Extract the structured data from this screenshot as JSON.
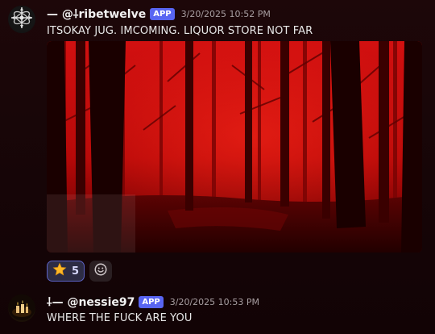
{
  "messages": [
    {
      "username": "— @⸸ribetwelve",
      "badge": "APP",
      "timestamp": "3/20/2025 10:52 PM",
      "text": "ITSOKAY JUG. IMCOMING. LIQUOR STORE NOT FAR",
      "avatar_icon": "orbital-cross-icon",
      "attachment": {
        "kind": "image",
        "subject": "red-tinted forest"
      },
      "reactions": [
        {
          "emoji": "⭐",
          "icon": "star-icon",
          "count": "5"
        }
      ]
    },
    {
      "username": "⸸— @nessie97",
      "badge": "APP",
      "timestamp": "3/20/2025 10:53 PM",
      "text": "WHERE THE FUCK ARE YOU",
      "avatar_icon": "candles-avatar-icon"
    }
  ],
  "colors": {
    "background": "#1a0608",
    "badge": "#5865f2",
    "reaction_border": "#5b61c4",
    "image_tint": "#c00a0a"
  }
}
